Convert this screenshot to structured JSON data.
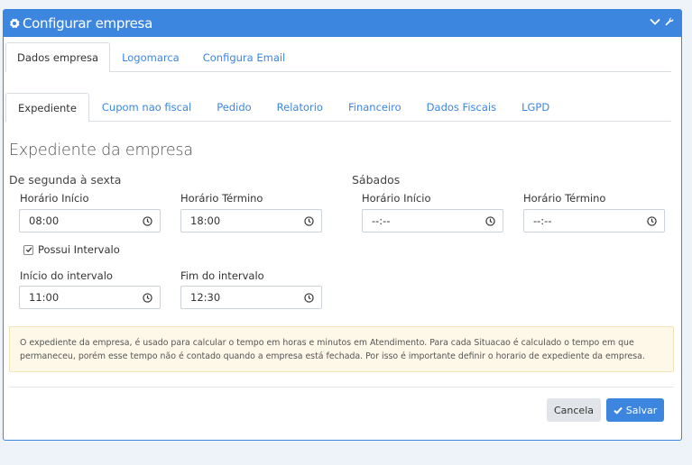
{
  "header": {
    "title": "Configurar empresa"
  },
  "tabs_main": [
    {
      "label": "Dados empresa",
      "active": true
    },
    {
      "label": "Logomarca",
      "active": false
    },
    {
      "label": "Configura Email",
      "active": false
    }
  ],
  "tabs_sub": [
    {
      "label": "Expediente",
      "active": true
    },
    {
      "label": "Cupom nao fiscal",
      "active": false
    },
    {
      "label": "Pedido",
      "active": false
    },
    {
      "label": "Relatorio",
      "active": false
    },
    {
      "label": "Financeiro",
      "active": false
    },
    {
      "label": "Dados Fiscais",
      "active": false
    },
    {
      "label": "LGPD",
      "active": false
    }
  ],
  "section_title": "Expediente da empresa",
  "weekdays": {
    "title": "De segunda à sexta",
    "start_label": "Horário Início",
    "start_value": "08:00",
    "end_label": "Horário Término",
    "end_value": "18:00",
    "interval_label": "Possui Intervalo",
    "interval_checked": true,
    "interval_start_label": "Início do intervalo",
    "interval_start_value": "11:00",
    "interval_end_label": "Fim do intervalo",
    "interval_end_value": "12:30"
  },
  "saturday": {
    "title": "Sábados",
    "start_label": "Horário Início",
    "start_value": "--:--",
    "end_label": "Horário Término",
    "end_value": "--:--"
  },
  "alert_text": "O expediente da empresa, é usado para calcular o tempo em horas e minutos em Atendimento. Para cada Situacao é calculado o tempo em que permaneceu, porém esse tempo não é contado quando a empresa está fechada. Por isso é importante definir o horario de expediente da empresa.",
  "buttons": {
    "cancel": "Cancela",
    "save": "Salvar"
  },
  "colors": {
    "primary": "#3d86e0",
    "alert_bg": "#fdf8e7",
    "page_bg": "#eef2f9"
  }
}
